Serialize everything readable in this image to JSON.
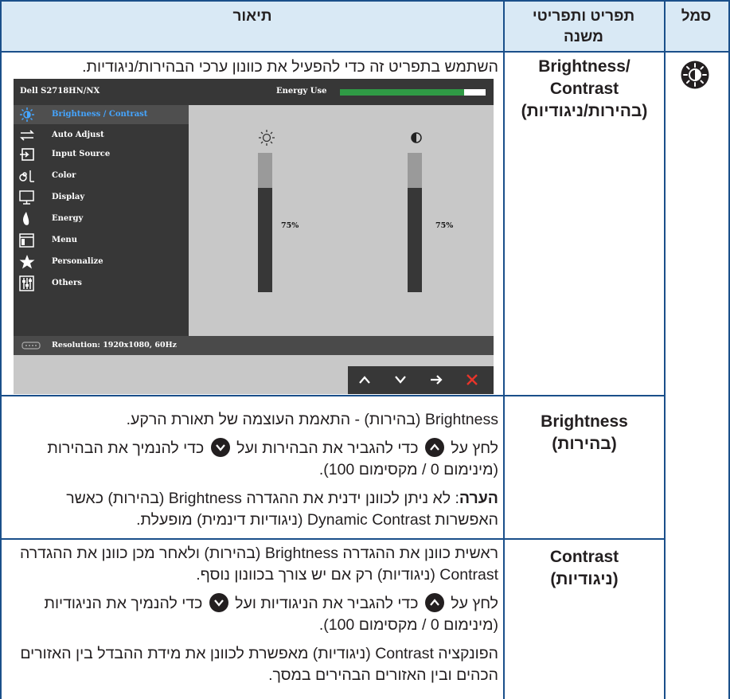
{
  "header": {
    "symbol": "סמל",
    "submenu": "תפריט ותפריטי משנה",
    "description": "תיאור"
  },
  "symbol_icon": "brightness-contrast-icon",
  "rows": [
    {
      "name": "Brightness/ Contrast (בהירות/ניגודיות)",
      "name_lines": [
        "Brightness/",
        "Contrast",
        "(בהירות/ניגודיות)"
      ],
      "text": "השתמש בתפריט זה כדי להפעיל את כוונון ערכי הבהירות/ניגודיות."
    },
    {
      "name": "Brightness (בהירות)",
      "name_lines": [
        "Brightness",
        "(בהירות)"
      ],
      "p1": "Brightness (בהירות) - התאמת העוצמה של תאורת הרקע.",
      "p2_before_up": "לחץ על",
      "p2_mid": "כדי להגביר את הבהירות ועל",
      "p2_after_down": "כדי להנמיך את הבהירות (מינימום 0 / מקסימום 100).",
      "note_label": "הערה",
      "note_text": ": לא ניתן לכוונן ידנית את ההגדרה Brightness (בהירות) כאשר האפשרות Dynamic Contrast (ניגודיות דינמית) מופעלת."
    },
    {
      "name": "Contrast (ניגודיות)",
      "name_lines": [
        "Contrast",
        "(ניגודיות)"
      ],
      "p1": "ראשית כוונן את ההגדרה Brightness (בהירות) ולאחר מכן כוונן את ההגדרה Contrast (ניגודיות) רק אם יש צורך בכוונון נוסף.",
      "p2_before_up": "לחץ על",
      "p2_mid": "כדי להגביר את הניגודיות ועל",
      "p2_after_down": "כדי להנמיך את הניגודיות (מינימום 0 / מקסימום 100).",
      "p3": "הפונקציה Contrast (ניגודיות) מאפשרת לכוונן את מידת ההבדל בין האזורים הכהים ובין האזורים הבהירים במסך."
    }
  ],
  "osd": {
    "model": "Dell S2718HN/NX",
    "energy_label": "Energy Use",
    "energy_level": 0.85,
    "menu": [
      {
        "label": "Brightness / Contrast",
        "icon": "brightness-icon",
        "selected": true
      },
      {
        "label": "Auto Adjust",
        "icon": "auto-adjust-icon"
      },
      {
        "label": "Input Source",
        "icon": "input-source-icon"
      },
      {
        "label": "Color",
        "icon": "color-icon"
      },
      {
        "label": "Display",
        "icon": "display-icon"
      },
      {
        "label": "Energy",
        "icon": "energy-icon"
      },
      {
        "label": "Menu",
        "icon": "menu-icon"
      },
      {
        "label": "Personalize",
        "icon": "star-icon"
      },
      {
        "label": "Others",
        "icon": "others-icon"
      }
    ],
    "brightness_value": "75%",
    "contrast_value": "75%",
    "brightness_level": 0.75,
    "contrast_level": 0.75,
    "resolution": "Resolution: 1920x1080, 60Hz",
    "nav_buttons": [
      "up-icon",
      "down-icon",
      "right-arrow-icon",
      "close-icon"
    ],
    "colors": {
      "selected_text": "#45a5ff",
      "energy_bar": "#2f9a45",
      "close": "#e8342a"
    }
  }
}
